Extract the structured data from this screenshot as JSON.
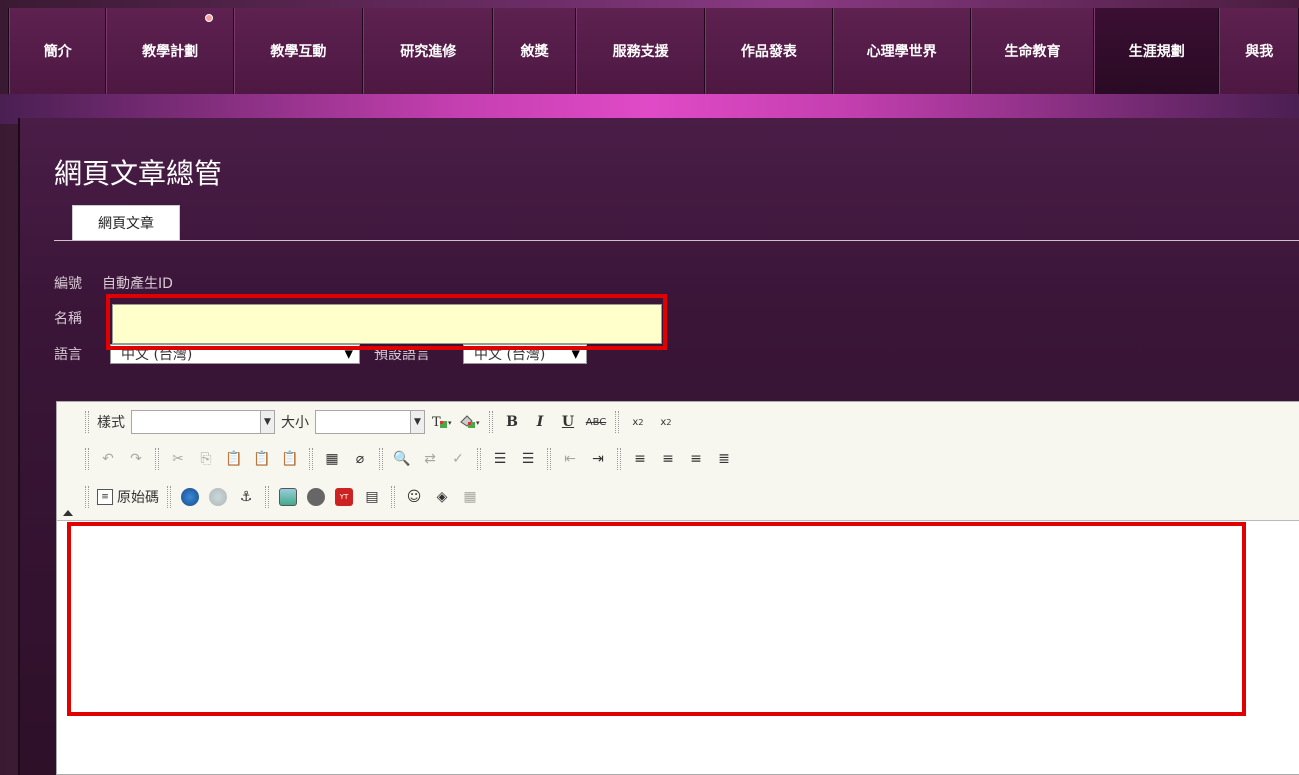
{
  "nav": {
    "items": [
      {
        "label": "簡介",
        "w": 98
      },
      {
        "label": "教學計劃",
        "w": 128
      },
      {
        "label": "教學互動",
        "w": 130
      },
      {
        "label": "研究進修",
        "w": 131
      },
      {
        "label": "敘獎",
        "w": 83
      },
      {
        "label": "服務支援",
        "w": 130
      },
      {
        "label": "作品發表",
        "w": 128
      },
      {
        "label": "心理學世界",
        "w": 139
      },
      {
        "label": "生命教育",
        "w": 124
      },
      {
        "label": "生涯規劃",
        "w": 126
      },
      {
        "label": "與我",
        "w": 80
      }
    ],
    "active_index": 9
  },
  "page_title": "網頁文章總管",
  "tab": {
    "label": "網頁文章"
  },
  "form": {
    "id_label": "編號",
    "id_value": "自動產生ID",
    "name_label": "名稱",
    "name_value": "",
    "language_label": "語言",
    "language_value": "中文 (台灣)",
    "default_language_label": "預設語言",
    "default_language_value": "中文 (台灣)"
  },
  "toolbar": {
    "style_label": "樣式",
    "size_label": "大小",
    "source_label": "原始碼"
  },
  "colors": {
    "highlight": "#e00000",
    "input_bg": "#ffffcc"
  }
}
